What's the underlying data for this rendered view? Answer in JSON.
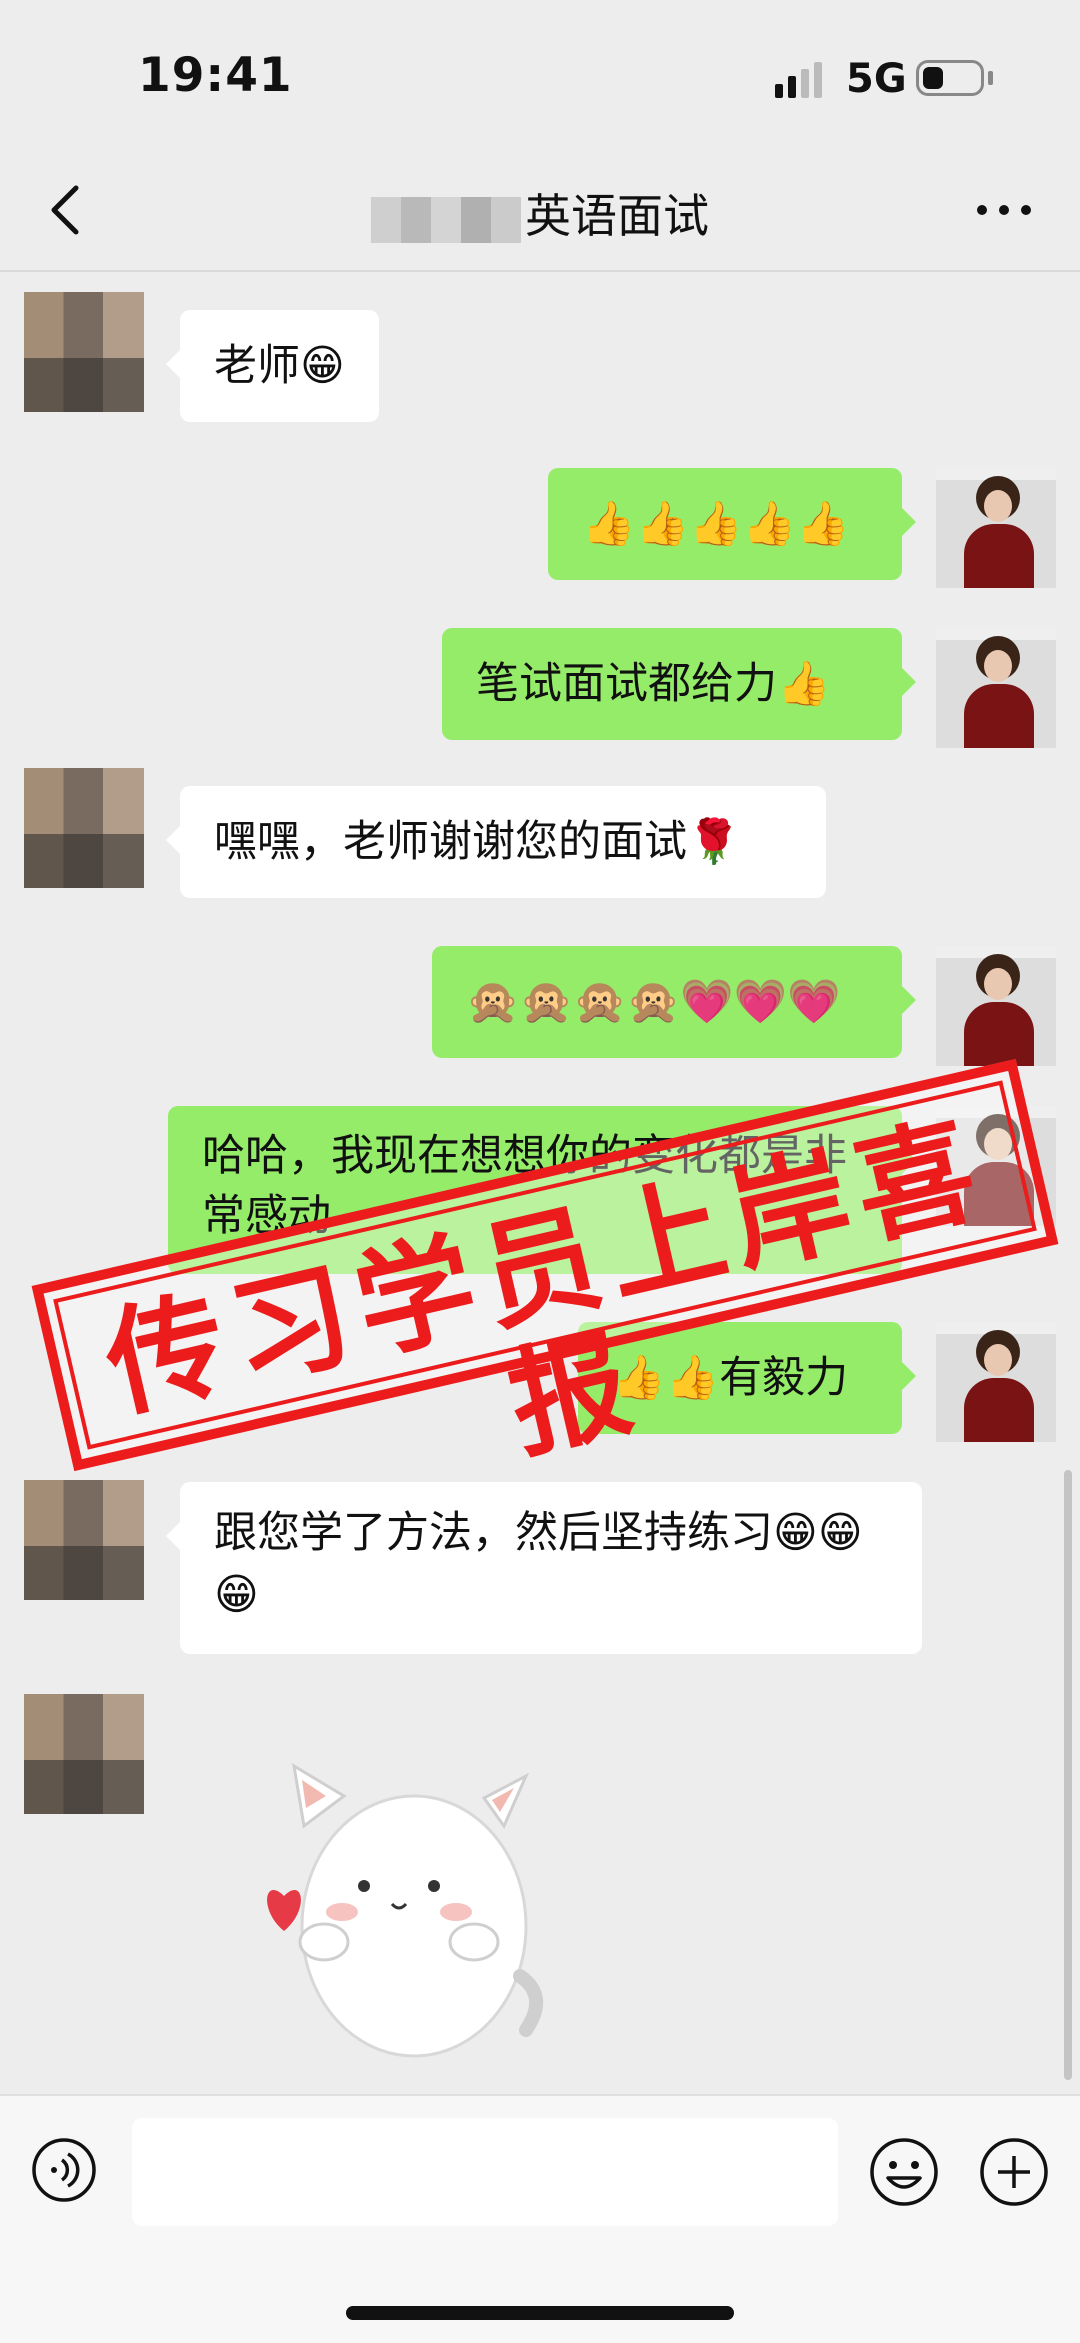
{
  "status_bar": {
    "time": "19:41",
    "network": "5G"
  },
  "header": {
    "title": "英语面试"
  },
  "messages": [
    {
      "side": "in",
      "text": "老师😁"
    },
    {
      "side": "out",
      "text": "👍👍👍👍👍"
    },
    {
      "side": "out",
      "text": "笔试面试都给力👍"
    },
    {
      "side": "in",
      "text": "嘿嘿，老师谢谢您的面试🌹"
    },
    {
      "side": "out",
      "text": "🙊🙊🙊🙊💗💗💗"
    },
    {
      "side": "out",
      "text": "哈哈，我现在想想你的变化都是非常感动"
    },
    {
      "side": "out",
      "text": "👍👍有毅力"
    },
    {
      "side": "in",
      "text": "跟您学了方法，然后坚持练习😁😁😁"
    }
  ],
  "stamp": {
    "text": "传习学员上岸喜报",
    "color": "#ec1c1c"
  },
  "colors": {
    "outgoing_bubble": "#95ec69",
    "incoming_bubble": "#ffffff",
    "background": "#ededed"
  }
}
